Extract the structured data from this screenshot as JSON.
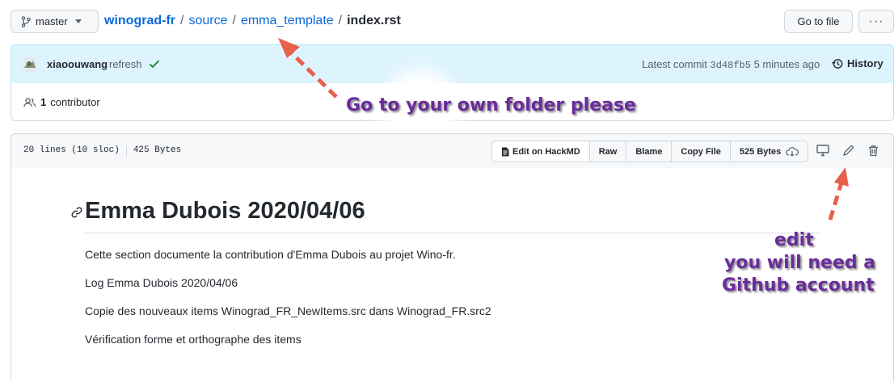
{
  "breadcrumb": {
    "branch": "master",
    "repo": "winograd-fr",
    "sep": "/",
    "path1": "source",
    "path2": "emma_template",
    "file": "index.rst"
  },
  "header_buttons": {
    "goto_file": "Go to file",
    "more": "···"
  },
  "commit": {
    "author": "xiaoouwang",
    "message": "refresh",
    "latest_label": "Latest commit",
    "sha": "3d48fb5",
    "time": "5 minutes ago",
    "history_label": "History"
  },
  "contributors": {
    "count": "1",
    "label": "contributor"
  },
  "file_info": {
    "lines": "20 lines (10 sloc)",
    "size": "425 Bytes"
  },
  "file_buttons": {
    "edit_hackmd": "Edit on HackMD",
    "raw": "Raw",
    "blame": "Blame",
    "copy_file": "Copy File",
    "download_size": "525 Bytes"
  },
  "document": {
    "title": "Emma Dubois 2020/04/06",
    "paragraphs": [
      "Cette section documente la contribution d'Emma Dubois au projet Wino-fr.",
      "Log Emma Dubois 2020/04/06",
      "Copie des nouveaux items Winograd_FR_NewItems.src dans Winograd_FR.src2",
      "Vérification forme et orthographe des items"
    ]
  },
  "annotations": {
    "folder_note": "Go to your own folder please",
    "edit_note_1": "edit",
    "edit_note_2": "you will need a",
    "edit_note_3": "Github account"
  },
  "colors": {
    "link": "#0969da",
    "commit_bg": "#ddf4ff",
    "annotation_text": "#6a2c9c",
    "arrow": "#e8604c"
  }
}
